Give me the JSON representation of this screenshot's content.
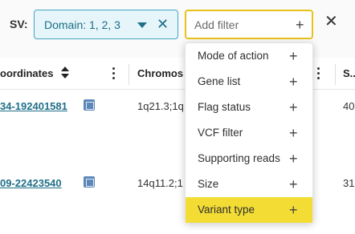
{
  "filter_bar": {
    "sv_label": "SV:",
    "chip_text": "Domain: 1, 2, 3",
    "add_filter_placeholder": "Add filter",
    "plus": "+",
    "close": "✕",
    "chip_close": "✕"
  },
  "table": {
    "headers": [
      "oordinates",
      "Chromos",
      "",
      "S..."
    ],
    "rows": [
      {
        "coordinates": "34-192401581",
        "chromosome": "1q21.3;1q",
        "last": "40"
      },
      {
        "coordinates": "09-22423540",
        "chromosome": "14q11.2;1",
        "last": "31"
      }
    ]
  },
  "dropdown": {
    "items": [
      {
        "label": "Mode of action",
        "active": false
      },
      {
        "label": "Gene list",
        "active": false
      },
      {
        "label": "Flag status",
        "active": false
      },
      {
        "label": "VCF filter",
        "active": false
      },
      {
        "label": "Supporting reads",
        "active": false
      },
      {
        "label": "Size",
        "active": false
      },
      {
        "label": "Variant type",
        "active": true
      }
    ],
    "plus": "+"
  },
  "colors": {
    "accent_yellow": "#f3dd35",
    "chip_bg": "#e6f5f9",
    "chip_border": "#42a6c4",
    "link": "#1f6f88"
  }
}
